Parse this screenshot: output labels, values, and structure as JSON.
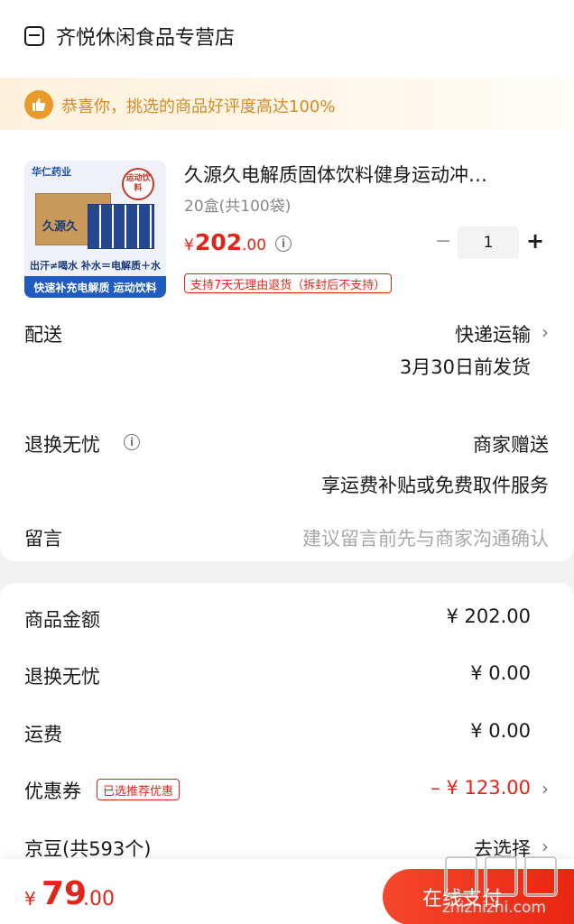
{
  "store": {
    "name": "齐悦休闲食品专营店"
  },
  "banner": {
    "text": "恭喜你，挑选的商品好评度高达100%"
  },
  "product": {
    "image_text": {
      "brand": "华仁药业",
      "box_label": "久源久",
      "tag": "运动饮料",
      "line1": "出汗≠喝水 补水＝电解质＋水",
      "line2": "快速补充电解质 运动饮料"
    },
    "title": "久源久电解质固体饮料健身运动冲…",
    "spec": "20盒(共100袋)",
    "price_currency": "¥",
    "price_int": "202",
    "price_dec": ".00",
    "quantity": "1",
    "return_tag": "支持7天无理由退货（拆封后不支持）"
  },
  "delivery": {
    "label": "配送",
    "method": "快递运输",
    "ship_date": "3月30日前发货"
  },
  "worry_free": {
    "label": "退换无忧",
    "value": "商家赠送",
    "note": "享运费补贴或免费取件服务"
  },
  "message": {
    "label": "留言",
    "placeholder": "建议留言前先与商家沟通确认"
  },
  "summary": {
    "goods_amount_label": "商品金额",
    "goods_amount": "¥ 202.00",
    "worry_free_label": "退换无忧",
    "worry_free_amount": "¥ 0.00",
    "shipping_label": "运费",
    "shipping_amount": "¥ 0.00",
    "coupon_label": "优惠券",
    "coupon_tag": "已选推荐优惠",
    "coupon_amount": "– ¥ 123.00",
    "jingdou_label": "京豆(共593个)",
    "jingdou_action": "去选择"
  },
  "footer": {
    "total_currency": "¥",
    "total_int": "79",
    "total_dec": ".00",
    "pay_label": "在线支付",
    "watermark_site": "zhizhizhi.com"
  },
  "colors": {
    "accent_red": "#e1251b",
    "banner_orange": "#d58a25"
  }
}
